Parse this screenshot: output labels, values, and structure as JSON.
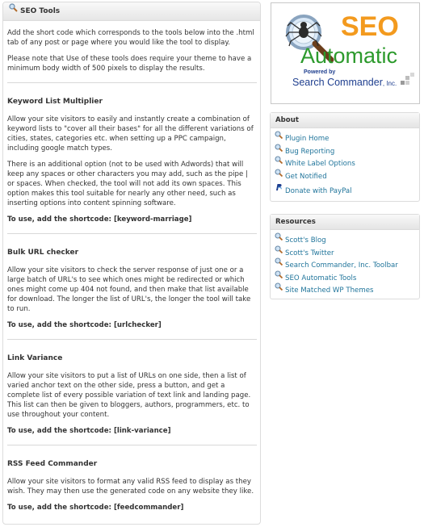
{
  "main": {
    "title": "SEO Tools",
    "intro": [
      "Add the short code which corresponds to the tools below into the .html tab of any post or page where you would like the tool to display.",
      "Please note that Use of these tools does require your theme to have a minimum body width of 500 pixels to display the results."
    ],
    "sections": [
      {
        "title": "Keyword List Multiplier",
        "paragraphs": [
          "Allow your site visitors to easily and instantly create a combination of keyword lists to \"cover all their bases\" for all the different variations of cities, states, categories etc. when setting up a PPC campaign, including google match types.",
          "There is an additional option (not to be used with Adwords) that will keep any spaces or other characters you may add, such as the pipe | or spaces. When checked, the tool will not add its own spaces. This option makes this tool suitable for nearly any other need, such as inserting options into content spinning software."
        ],
        "shortcode": "To use, add the shortcode: [keyword-marriage]"
      },
      {
        "title": "Bulk URL checker",
        "paragraphs": [
          "Allow your site visitors to check the server response of just one or a large batch of URL's to see which ones might be redirected or which ones might come up 404 not found, and then make that list available for download. The longer the list of URL's, the longer the tool will take to run."
        ],
        "shortcode": "To use, add the shortcode: [urlchecker]"
      },
      {
        "title": "Link Variance",
        "paragraphs": [
          "Allow your site visitors to put a list of URLs on one side, then a list of varied anchor text on the other side, press a button, and get a complete list of every possible variation of text link and landing page. This list can then be given to bloggers, authors, programmers, etc. to use throughout your content."
        ],
        "shortcode": "To use, add the shortcode: [link-variance]"
      },
      {
        "title": "RSS Feed Commander",
        "paragraphs": [
          "Allow your site visitors to format any valid RSS feed to display as they wish. They may then use the generated code on any website they like."
        ],
        "shortcode": "To use, add the shortcode: [feedcommander]"
      }
    ]
  },
  "logo": {
    "line1": "SEO",
    "line2": "Automatic",
    "powered_by": "Powered by",
    "brand": "Search Commander",
    "brand_suffix": ", Inc."
  },
  "about": {
    "title": "About",
    "items": [
      {
        "label": "Plugin Home",
        "icon": "magnifier-icon"
      },
      {
        "label": "Bug Reporting",
        "icon": "magnifier-icon"
      },
      {
        "label": "White Label Options",
        "icon": "magnifier-icon"
      },
      {
        "label": "Get Notified",
        "icon": "magnifier-icon"
      },
      {
        "label": "Donate with PayPal",
        "icon": "paypal-icon"
      }
    ]
  },
  "resources": {
    "title": "Resources",
    "items": [
      {
        "label": "Scott's Blog",
        "icon": "magnifier-icon"
      },
      {
        "label": "Scott's Twitter",
        "icon": "magnifier-icon"
      },
      {
        "label": "Search Commander, Inc. Toolbar",
        "icon": "magnifier-icon"
      },
      {
        "label": "SEO Automatic Tools",
        "icon": "magnifier-icon"
      },
      {
        "label": "Site Matched WP Themes",
        "icon": "magnifier-icon"
      }
    ]
  },
  "colors": {
    "link": "#21759b",
    "logo_orange": "#f39a1e",
    "logo_green": "#2c9a2c",
    "logo_blue": "#1f3f8f"
  }
}
